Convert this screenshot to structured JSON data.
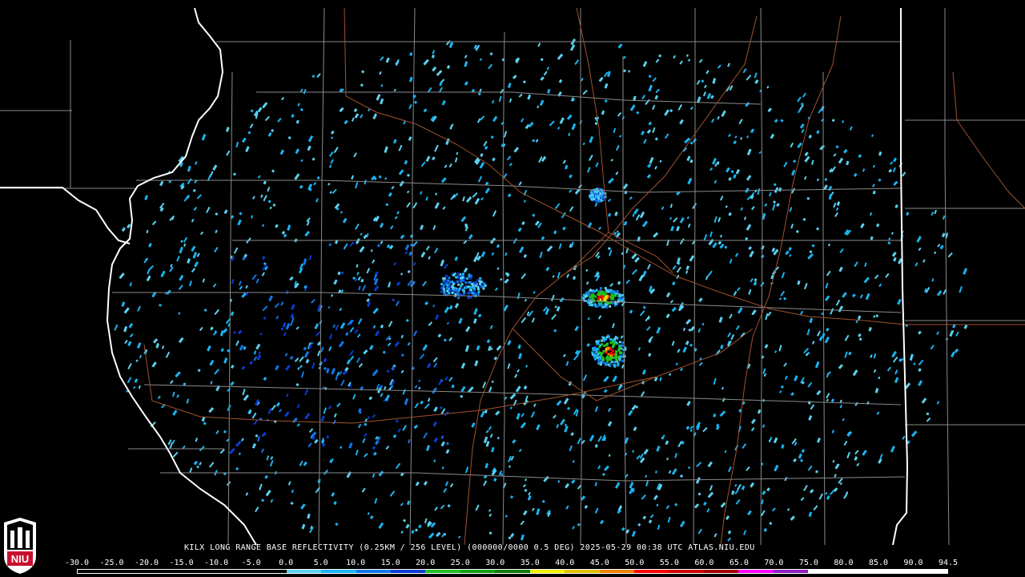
{
  "caption": "KILX LONG RANGE BASE REFLECTIVITY (0.25KM / 256 LEVEL) (000000/0000 0.5 DEG) 2025-05-29 00:38 UTC  ATLAS.NIU.EDU",
  "logo_text": "NIU",
  "scale": {
    "labels": [
      "-30.0",
      "-25.0",
      "-20.0",
      "-15.0",
      "-10.0",
      "-5.0",
      "0.0",
      "5.0",
      "10.0",
      "15.0",
      "20.0",
      "25.0",
      "30.0",
      "35.0",
      "40.0",
      "45.0",
      "50.0",
      "55.0",
      "60.0",
      "65.0",
      "70.0",
      "75.0",
      "80.0",
      "85.0",
      "90.0",
      "94.5"
    ],
    "colors": [
      "#000000",
      "#000000",
      "#000000",
      "#000000",
      "#000000",
      "#000000",
      "#5ad2f0",
      "#1ab4f2",
      "#1078e8",
      "#0a3cd0",
      "#20c020",
      "#10a010",
      "#0b7a0b",
      "#f0f000",
      "#e0c000",
      "#f08000",
      "#ff0000",
      "#d00000",
      "#a00000",
      "#ff00ff",
      "#9020c0",
      "#ffffff",
      "#ffffff",
      "#ffffff",
      "#ffffff"
    ]
  },
  "map": {
    "state_border_color": "#ffffff",
    "county_line_color": "#8a8a8a",
    "highway_color": "#a0522d",
    "echo_colors": [
      "#5ad2f0",
      "#1ab4f2",
      "#1078e8",
      "#0a3cd0"
    ],
    "storm_colors": [
      "#20c020",
      "#f0f000",
      "#f08000",
      "#ff0000"
    ]
  }
}
